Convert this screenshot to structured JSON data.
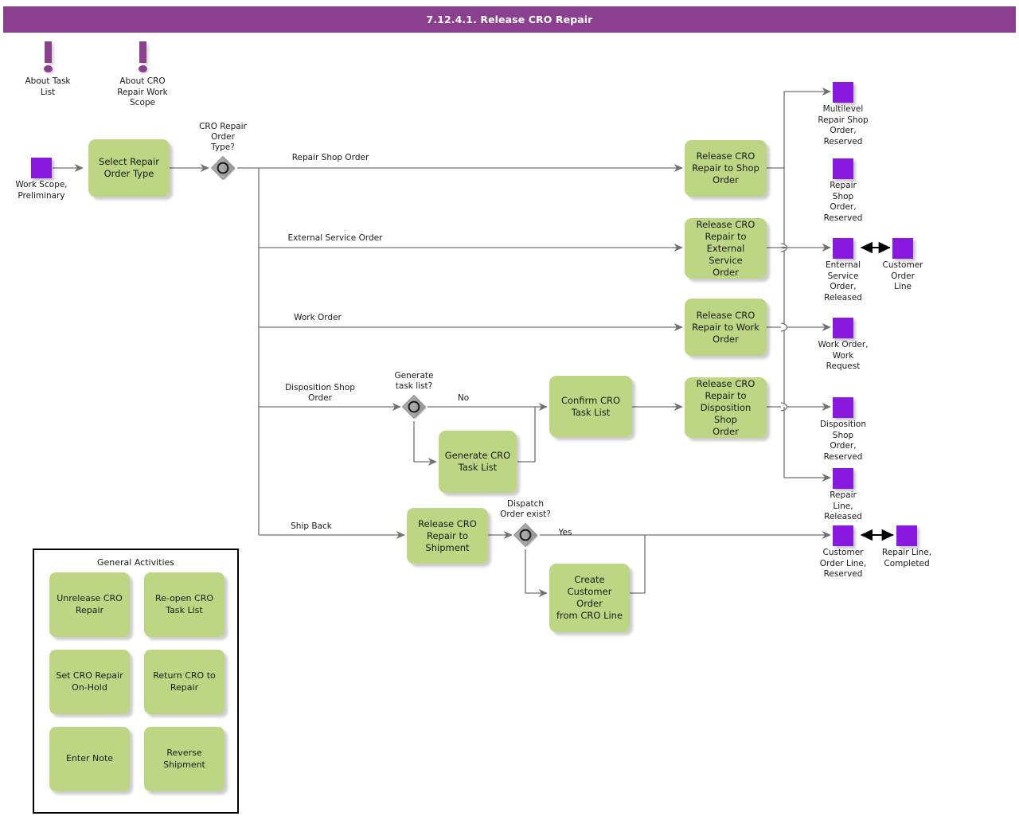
{
  "header": {
    "title": "7.12.4.1. Release CRO Repair",
    "bar_color": "#8a3f8f",
    "text_color": "#ffffff"
  },
  "theme": {
    "activity_fill": "#bdd684",
    "event_fill": "#8a19e0",
    "gateway_fill": "#909090",
    "connector": "#707070",
    "annotation": "#8a3f8f",
    "canvas": "#ffffff"
  },
  "annotations": [
    {
      "name": "about-task-list",
      "label": "About Task\nList"
    },
    {
      "name": "about-cro-repair-work-scope",
      "label": "About CRO\nRepair Work\nScope"
    }
  ],
  "start_events": [
    {
      "name": "work-scope-preliminary",
      "label": "Work Scope,\nPreliminary"
    }
  ],
  "activities": [
    {
      "name": "select-repair-order-type",
      "label": "Select Repair\nOrder Type"
    },
    {
      "name": "release-cro-repair-to-shop-order",
      "label": "Release CRO\nRepair to Shop\nOrder"
    },
    {
      "name": "release-cro-repair-to-external-service-order",
      "label": "Release CRO\nRepair to\nExternal Service\nOrder"
    },
    {
      "name": "release-cro-repair-to-work-order",
      "label": "Release CRO\nRepair to Work\nOrder"
    },
    {
      "name": "generate-cro-task-list",
      "label": "Generate CRO\nTask List"
    },
    {
      "name": "confirm-cro-task-list",
      "label": "Confirm CRO\nTask List"
    },
    {
      "name": "release-cro-repair-to-disposition-shop-order",
      "label": "Release CRO\nRepair to\nDisposition Shop\nOrder"
    },
    {
      "name": "release-cro-repair-to-shipment",
      "label": "Release CRO\nRepair to\nShipment"
    },
    {
      "name": "create-customer-order-from-cro-line",
      "label": "Create\nCustomer Order\nfrom CRO Line"
    }
  ],
  "gateways": [
    {
      "name": "cro-repair-order-type",
      "label": "CRO Repair\nOrder\nType?"
    },
    {
      "name": "generate-task-list",
      "label": "Generate\ntask list?"
    },
    {
      "name": "dispatch-order-exist",
      "label": "Dispatch\nOrder exist?"
    }
  ],
  "flow_labels": [
    {
      "name": "flow-repair-shop-order",
      "label": "Repair Shop Order"
    },
    {
      "name": "flow-external-service-order",
      "label": "External Service Order"
    },
    {
      "name": "flow-work-order",
      "label": "Work Order"
    },
    {
      "name": "flow-disposition-shop-order",
      "label": "Disposition Shop\nOrder"
    },
    {
      "name": "flow-ship-back",
      "label": "Ship Back"
    },
    {
      "name": "flow-generate-task-list-no",
      "label": "No"
    },
    {
      "name": "flow-dispatch-order-yes",
      "label": "Yes"
    }
  ],
  "end_events": [
    {
      "name": "multilevel-repair-shop-order-reserved",
      "label": "Multilevel\nRepair Shop\nOrder,\nReserved"
    },
    {
      "name": "repair-shop-order-reserved",
      "label": "Repair\nShop\nOrder,\nReserved"
    },
    {
      "name": "enternal-service-order-released",
      "label": "Enternal\nService\nOrder,\nReleased"
    },
    {
      "name": "customer-order-line",
      "label": "Customer\nOrder\nLine"
    },
    {
      "name": "work-order-work-request",
      "label": "Work Order,\nWork\nRequest"
    },
    {
      "name": "disposition-shop-order-reserved",
      "label": "Disposition\nShop\nOrder,\nReserved"
    },
    {
      "name": "repair-line-released",
      "label": "Repair\nLine,\nReleased"
    },
    {
      "name": "customer-order-line-reserved",
      "label": "Customer\nOrder Line,\nReserved"
    },
    {
      "name": "repair-line-completed",
      "label": "Repair Line,\nCompleted"
    }
  ],
  "legend": {
    "title": "General Activities",
    "items": [
      {
        "name": "unrelease-cro-repair",
        "label": "Unrelease CRO\nRepair"
      },
      {
        "name": "re-open-cro-task-list",
        "label": "Re-open CRO\nTask List"
      },
      {
        "name": "set-cro-repair-on-hold",
        "label": "Set CRO Repair\nOn-Hold"
      },
      {
        "name": "return-cro-to-repair",
        "label": "Return CRO to\nRepair"
      },
      {
        "name": "enter-note",
        "label": "Enter Note"
      },
      {
        "name": "reverse-shipment",
        "label": "Reverse\nShipment"
      }
    ]
  }
}
